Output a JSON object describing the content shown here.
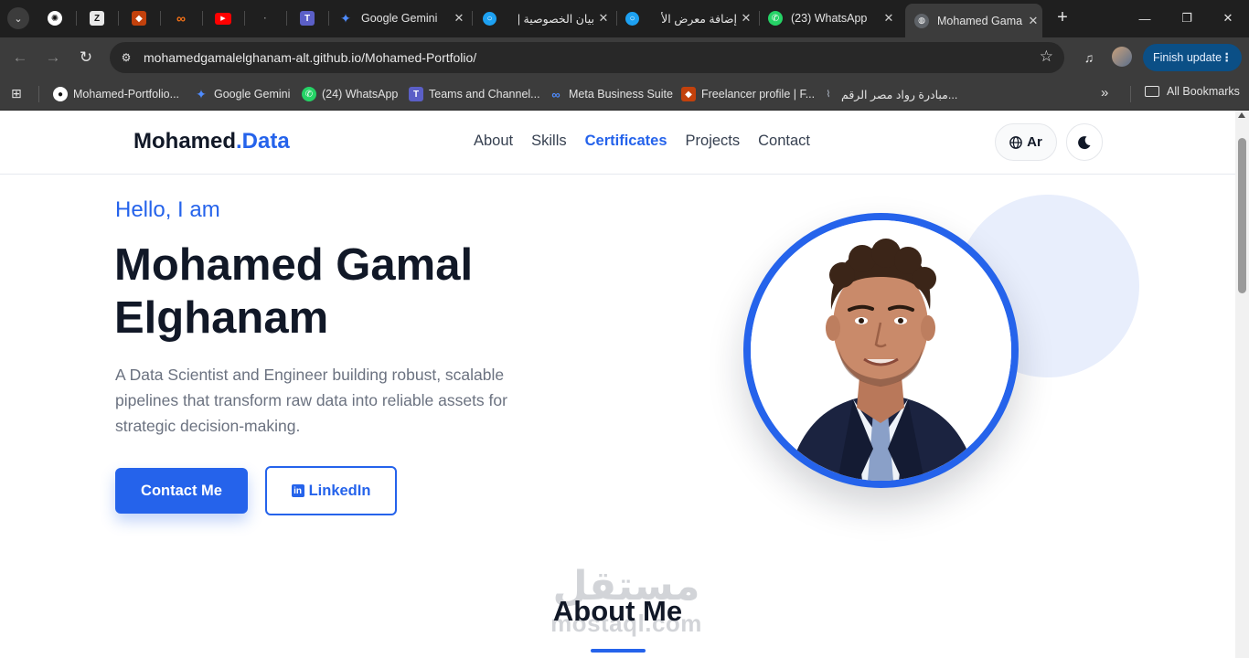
{
  "browser": {
    "tabs": [
      {
        "title": "Google Gemini",
        "icon": "gemini-icon"
      },
      {
        "title": "بيان الخصوصية |",
        "icon": "mostaql-icon"
      },
      {
        "title": "إضافة معرض الأ",
        "icon": "mostaql-icon"
      },
      {
        "title": "(23) WhatsApp",
        "icon": "whatsapp-icon"
      },
      {
        "title": "Mohamed Gama",
        "icon": "globe-icon",
        "active": true
      }
    ],
    "pinned_tabs": [
      "chatgpt-icon",
      "z-icon",
      "fox-icon",
      "infinity-icon",
      "youtube-icon",
      "dot-icon",
      "teams-icon"
    ],
    "url": "mohamedgamalelghanam-alt.github.io/Mohamed-Portfolio/",
    "update_button": "Finish update",
    "bookmarks": [
      {
        "label": "Mohamed-Portfolio...",
        "icon": "github-icon"
      },
      {
        "label": "Google Gemini",
        "icon": "gemini-icon"
      },
      {
        "label": "(24) WhatsApp",
        "icon": "whatsapp-icon"
      },
      {
        "label": "Teams and Channel...",
        "icon": "teams-icon"
      },
      {
        "label": "Meta Business Suite",
        "icon": "meta-icon"
      },
      {
        "label": "Freelancer profile | F...",
        "icon": "fox-icon"
      },
      {
        "label": "مبادرة رواد مصر الرقم...",
        "icon": "chart-icon"
      }
    ],
    "all_bookmarks": "All Bookmarks"
  },
  "site": {
    "logo": {
      "main": "Mohamed",
      "accent": ".Data"
    },
    "nav": [
      {
        "label": "About"
      },
      {
        "label": "Skills"
      },
      {
        "label": "Certificates",
        "active": true
      },
      {
        "label": "Projects"
      },
      {
        "label": "Contact"
      }
    ],
    "lang_button": "Ar",
    "greeting": "Hello, I am",
    "name": "Mohamed Gamal Elghanam",
    "description": "A Data Scientist and Engineer building robust, scalable pipelines that transform raw data into reliable assets for strategic decision-making.",
    "cta_primary": "Contact Me",
    "cta_secondary": "LinkedIn",
    "about_heading": "About Me",
    "watermark": {
      "arabic": "مستقل",
      "latin": "mostaql.com"
    }
  },
  "colors": {
    "accent": "#2563eb",
    "heading": "#111827",
    "muted": "#6b7280",
    "chrome_dark": "#1f1f1f",
    "chrome_toolbar": "#3c3c3c"
  }
}
